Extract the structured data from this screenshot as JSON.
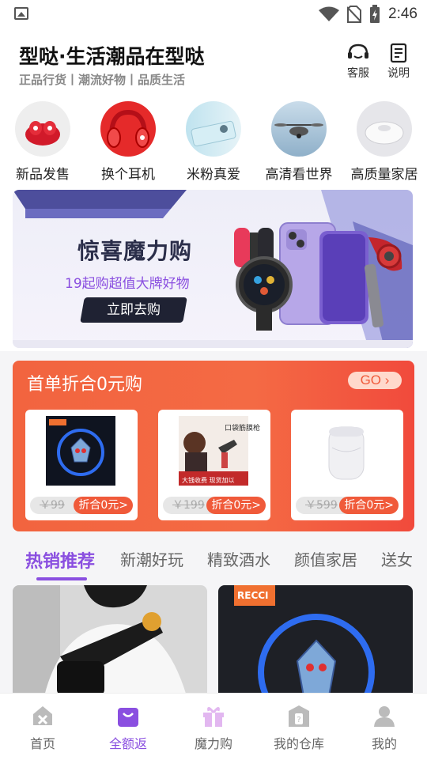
{
  "status": {
    "time": "2:46"
  },
  "header": {
    "title": "型哒·生活潮品在型哒",
    "subtitle": "正品行货丨潮流好物丨品质生活",
    "service_label": "客服",
    "help_label": "说明"
  },
  "categories": [
    {
      "label": "新品发售",
      "icon": "red-earbuds-icon"
    },
    {
      "label": "换个耳机",
      "icon": "red-headphones-icon"
    },
    {
      "label": "米粉真爱",
      "icon": "phone-icon"
    },
    {
      "label": "高清看世界",
      "icon": "drone-icon"
    },
    {
      "label": "高质量家居",
      "icon": "robot-vacuum-icon"
    }
  ],
  "banner": {
    "title": "惊喜魔力购",
    "subtitle": "19起购超值大牌好物",
    "button": "立即去购"
  },
  "promo": {
    "title": "首单折合0元购",
    "go_label": "GO",
    "products": [
      {
        "old_price": "￥99",
        "deal": "折合0元>"
      },
      {
        "old_price": "￥199",
        "deal": "折合0元>"
      },
      {
        "old_price": "￥599",
        "deal": "折合0元>"
      }
    ],
    "product2_text": {
      "top": "口袋筋膜枪",
      "bottom": "大钱收费 现货加以"
    },
    "product1_brand": "RECCI"
  },
  "tabs": [
    "热销推荐",
    "新潮好玩",
    "精致酒水",
    "颜值家居",
    "送女"
  ],
  "feed": {
    "card2_brand": "RECCI"
  },
  "bottom_nav": [
    {
      "label": "首页",
      "icon": "home-icon"
    },
    {
      "label": "全额返",
      "icon": "bag-icon"
    },
    {
      "label": "魔力购",
      "icon": "gift-icon"
    },
    {
      "label": "我的仓库",
      "icon": "warehouse-icon"
    },
    {
      "label": "我的",
      "icon": "user-icon"
    }
  ],
  "colors": {
    "accent": "#8a4fe0",
    "promo": "#f2643f"
  }
}
